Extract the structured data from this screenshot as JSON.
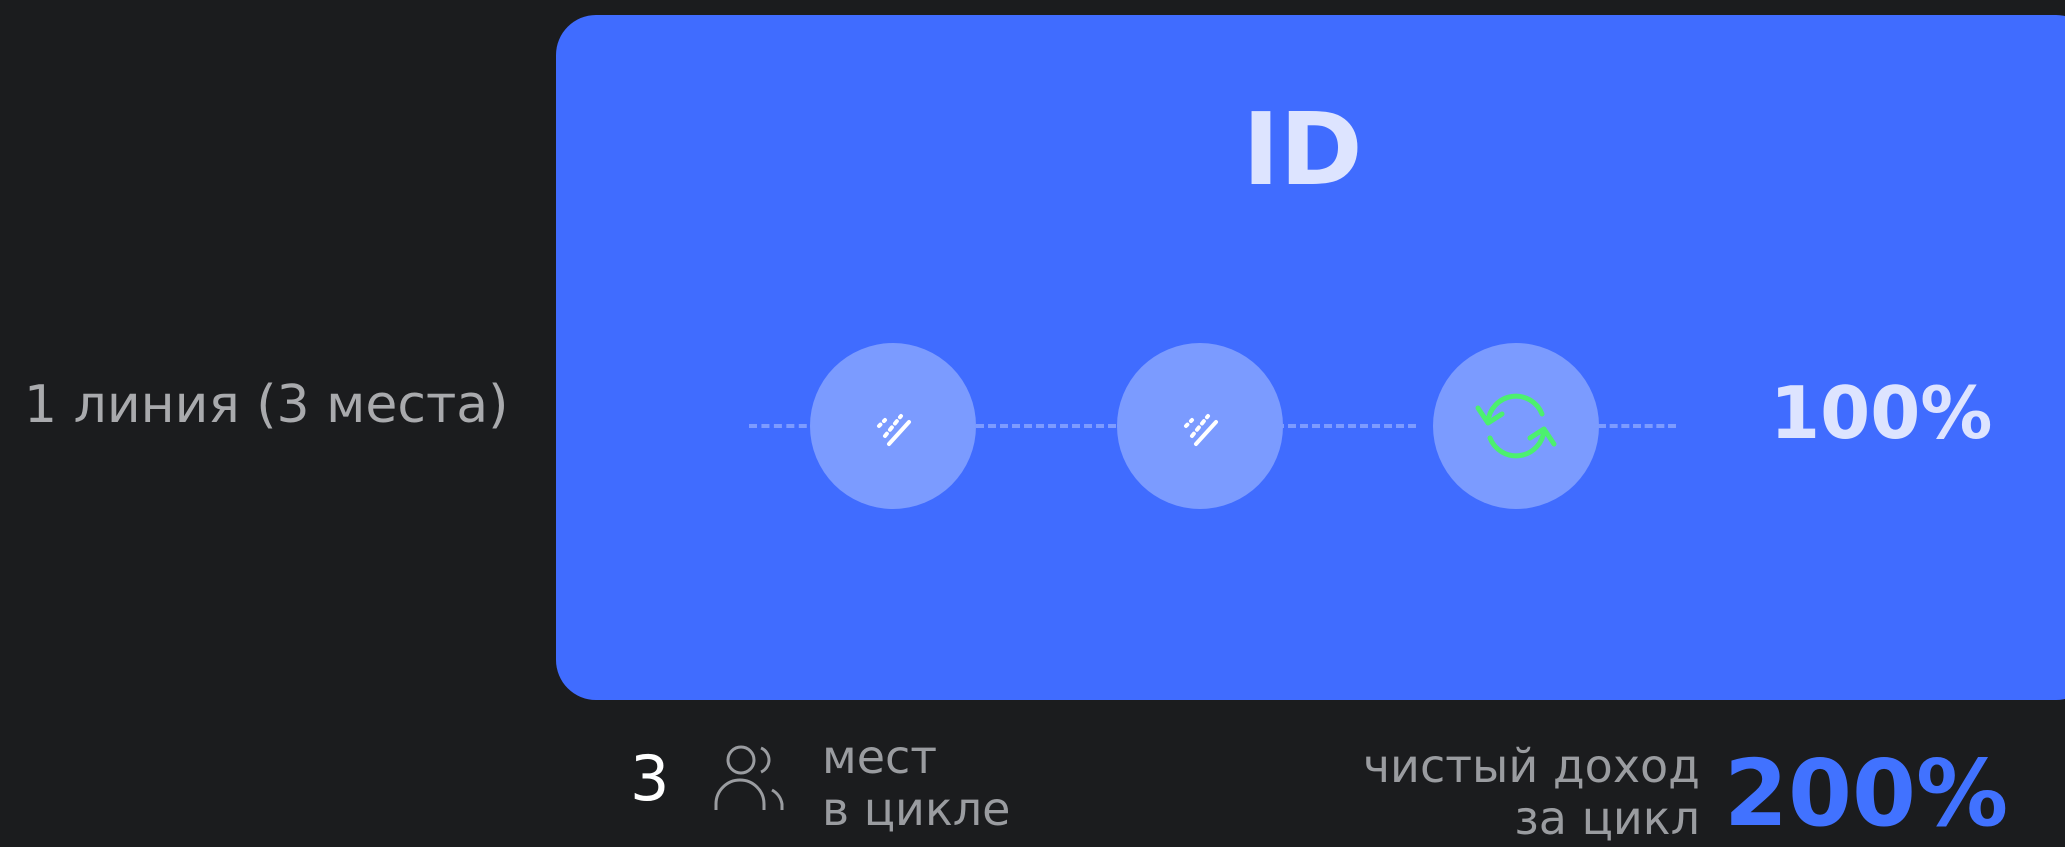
{
  "line": {
    "label": "1 линия (3 места)"
  },
  "card": {
    "title": "ID",
    "percent": "100%",
    "background_color": "#406cff",
    "slots": [
      {
        "icon": "stripes-icon",
        "state": "filled"
      },
      {
        "icon": "stripes-icon",
        "state": "filled"
      },
      {
        "icon": "refresh-icon",
        "state": "recycle",
        "icon_color": "#4cf06e"
      }
    ]
  },
  "footer": {
    "seats_count": "3",
    "seats_icon": "people-icon",
    "seats_label_line1": "мест",
    "seats_label_line2": "в цикле",
    "income_label_line1": "чистый доход",
    "income_label_line2": "за цикл",
    "income_value": "200%",
    "income_color": "#4172ff"
  }
}
